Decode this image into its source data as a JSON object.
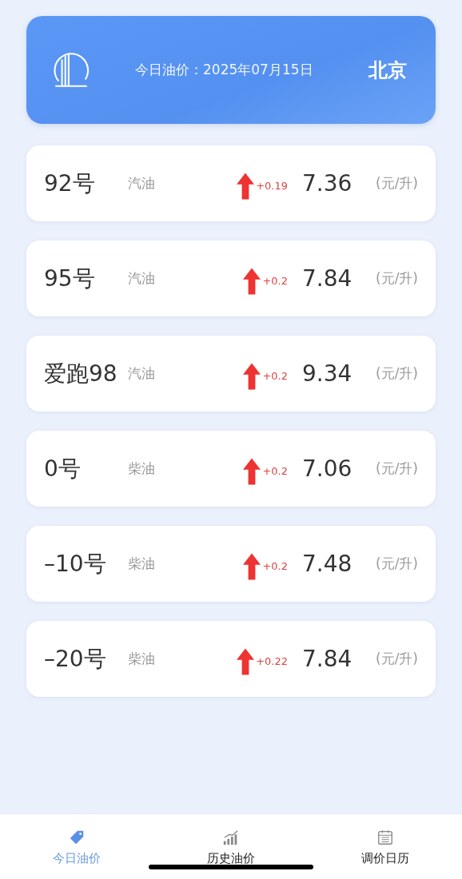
{
  "header": {
    "date_label": "今日油价：2025年07月15日",
    "city": "北京"
  },
  "prices": [
    {
      "grade": "92号",
      "type": "汽油",
      "kind": "up",
      "change": "+0.19",
      "price": "7.36",
      "unit": "(元/升)"
    },
    {
      "grade": "95号",
      "type": "汽油",
      "kind": "up",
      "change": "+0.2",
      "price": "7.84",
      "unit": "(元/升)"
    },
    {
      "grade": "爱跑98",
      "type": "汽油",
      "kind": "up",
      "change": "+0.2",
      "price": "9.34",
      "unit": "(元/升)"
    },
    {
      "grade": "0号",
      "type": "柴油",
      "kind": "up",
      "change": "+0.2",
      "price": "7.06",
      "unit": "(元/升)"
    },
    {
      "grade": "–10号",
      "type": "柴油",
      "kind": "up",
      "change": "+0.2",
      "price": "7.48",
      "unit": "(元/升)"
    },
    {
      "grade": "–20号",
      "type": "柴油",
      "kind": "up",
      "change": "+0.22",
      "price": "7.84",
      "unit": "(元/升)"
    }
  ],
  "tabs": [
    {
      "label": "今日油价",
      "kind": "tag",
      "selected": true
    },
    {
      "label": "历史油价",
      "kind": "chart",
      "selected": false
    },
    {
      "label": "调价日历",
      "kind": "calendar",
      "selected": false
    }
  ]
}
